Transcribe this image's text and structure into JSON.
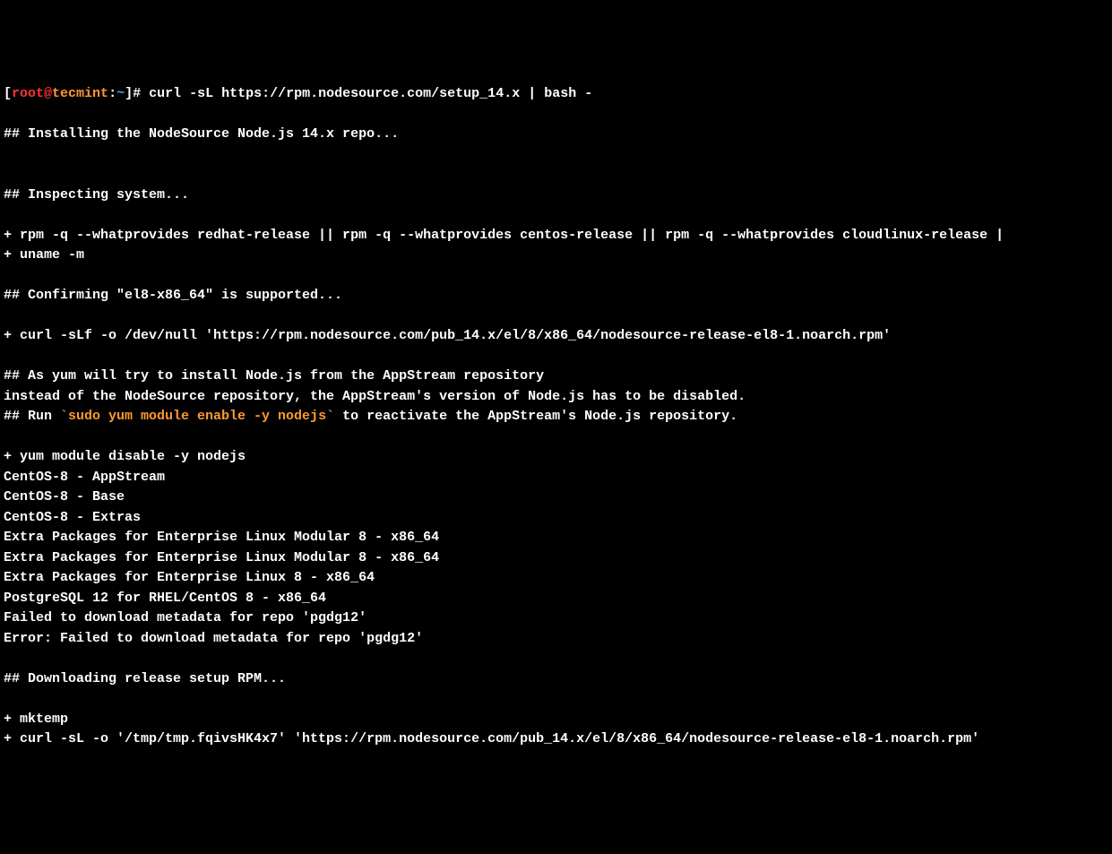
{
  "prompt": {
    "open_bracket": "[",
    "user": "root",
    "at": "@",
    "host": "tecmint",
    "colon": ":",
    "path": "~",
    "close_bracket": "]",
    "symbol": "# "
  },
  "command": "curl -sL https://rpm.nodesource.com/setup_14.x | bash -",
  "lines": {
    "l01": "",
    "l02": "## Installing the NodeSource Node.js 14.x repo...",
    "l03": "",
    "l04": "",
    "l05": "## Inspecting system...",
    "l06": "",
    "l07": "+ rpm -q --whatprovides redhat-release || rpm -q --whatprovides centos-release || rpm -q --whatprovides cloudlinux-release |",
    "l08": "+ uname -m",
    "l09": "",
    "l10": "## Confirming \"el8-x86_64\" is supported...",
    "l11": "",
    "l12": "+ curl -sLf -o /dev/null 'https://rpm.nodesource.com/pub_14.x/el/8/x86_64/nodesource-release-el8-1.noarch.rpm'",
    "l13": "",
    "l14": "## As yum will try to install Node.js from the AppStream repository",
    "l15": "instead of the NodeSource repository, the AppStream's version of Node.js has to be disabled.",
    "l16a": "## Run ",
    "l16b": "`sudo yum module enable -y nodejs`",
    "l16c": " to reactivate the AppStream's Node.js repository.",
    "l17": "",
    "l18": "+ yum module disable -y nodejs",
    "l19": "CentOS-8 - AppStream",
    "l20": "CentOS-8 - Base",
    "l21": "CentOS-8 - Extras",
    "l22": "Extra Packages for Enterprise Linux Modular 8 - x86_64",
    "l23": "Extra Packages for Enterprise Linux Modular 8 - x86_64",
    "l24": "Extra Packages for Enterprise Linux 8 - x86_64",
    "l25": "PostgreSQL 12 for RHEL/CentOS 8 - x86_64",
    "l26": "Failed to download metadata for repo 'pgdg12'",
    "l27": "Error: Failed to download metadata for repo 'pgdg12'",
    "l28": "",
    "l29": "## Downloading release setup RPM...",
    "l30": "",
    "l31": "+ mktemp",
    "l32": "+ curl -sL -o '/tmp/tmp.fqivsHK4x7' 'https://rpm.nodesource.com/pub_14.x/el/8/x86_64/nodesource-release-el8-1.noarch.rpm'"
  }
}
